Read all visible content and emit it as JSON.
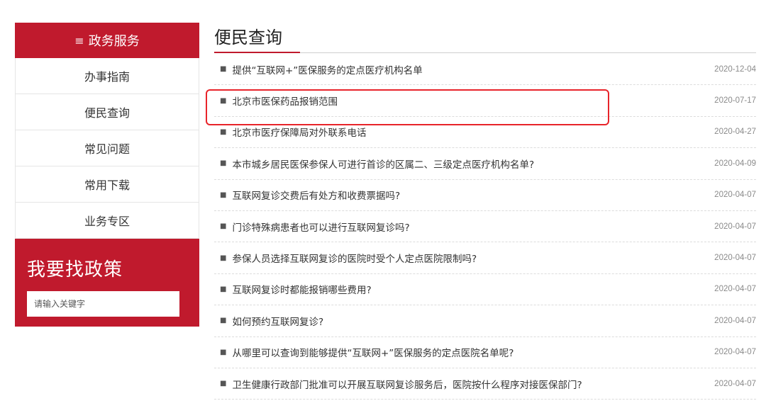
{
  "sidebar": {
    "header": {
      "icon": "menu-icon",
      "glyph": "≡",
      "label": "政务服务"
    },
    "items": [
      {
        "label": "办事指南"
      },
      {
        "label": "便民查询"
      },
      {
        "label": "常见问题"
      },
      {
        "label": "常用下载"
      },
      {
        "label": "业务专区"
      }
    ],
    "policy": {
      "title": "我要找政策",
      "placeholder": "请输入关键字"
    }
  },
  "main": {
    "title": "便民查询",
    "items": [
      {
        "text": "提供“互联网+”医保服务的定点医疗机构名单",
        "date": "2020-12-04"
      },
      {
        "text": "北京市医保药品报销范围",
        "date": "2020-07-17"
      },
      {
        "text": "北京市医疗保障局对外联系电话",
        "date": "2020-04-27"
      },
      {
        "text": "本市城乡居民医保参保人可进行首诊的区属二、三级定点医疗机构名单?",
        "date": "2020-04-09"
      },
      {
        "text": "互联网复诊交费后有处方和收费票据吗?",
        "date": "2020-04-07"
      },
      {
        "text": "门诊特殊病患者也可以进行互联网复诊吗?",
        "date": "2020-04-07"
      },
      {
        "text": "参保人员选择互联网复诊的医院时受个人定点医院限制吗?",
        "date": "2020-04-07"
      },
      {
        "text": "互联网复诊时都能报销哪些费用?",
        "date": "2020-04-07"
      },
      {
        "text": "如何预约互联网复诊?",
        "date": "2020-04-07"
      },
      {
        "text": "从哪里可以查询到能够提供“互联网+”医保服务的定点医院名单呢?",
        "date": "2020-04-07"
      },
      {
        "text": "卫生健康行政部门批准可以开展互联网复诊服务后，医院按什么程序对接医保部门?",
        "date": "2020-04-07"
      }
    ]
  },
  "colors": {
    "brand_red": "#c01a2d",
    "highlight_red": "#e8242a"
  },
  "highlight": {
    "target": "北京市医保药品报销范围"
  }
}
